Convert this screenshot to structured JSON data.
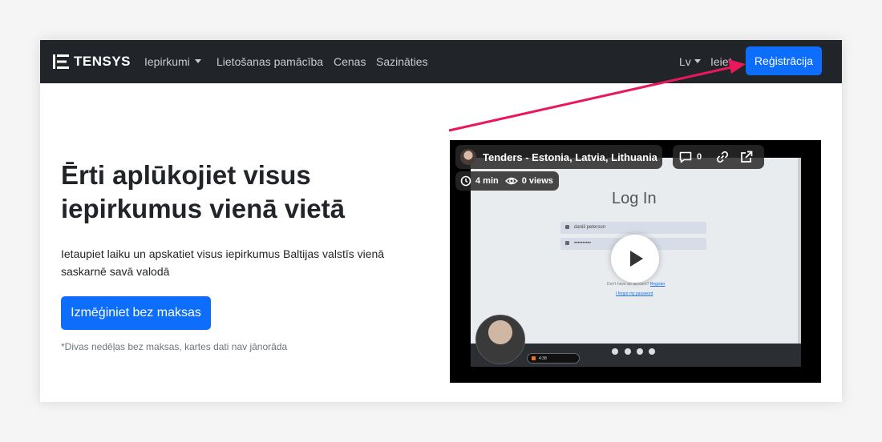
{
  "brand": {
    "logo_text": "TENSYS"
  },
  "nav": {
    "items": [
      {
        "label": "Iepirkumi",
        "dropdown": true
      },
      {
        "label": "Lietošanas pamācība"
      },
      {
        "label": "Cenas"
      },
      {
        "label": "Sazināties"
      }
    ],
    "language": "Lv",
    "login": "Ieiet",
    "register": "Reģistrācija"
  },
  "hero": {
    "title": "Ērti aplūkojiet visus iepirkumus vienā vietā",
    "description": "Ietaupiet laiku un apskatiet visus iepirkumus Baltijas valstīs vienā saskarnē savā valodā",
    "cta": "Izmēģiniet bez maksas",
    "footnote": "*Divas nedēļas bez maksas, kartes dati nav jānorāda"
  },
  "video": {
    "title": "Tenders - Estonia, Latvia, Lithuania",
    "duration": "4 min",
    "views": "0 views",
    "comments": "0",
    "screen": {
      "heading": "Log In",
      "username_value": "daniil peterson",
      "password_value": "••••••••••",
      "no_account_text": "Don't have an account?",
      "register_link": "Register",
      "forgot_link": "I forgot my password",
      "rec_time": "4:38"
    }
  },
  "colors": {
    "accent": "#0d6efd",
    "navbar": "#212529",
    "arrow": "#e8185a"
  },
  "icons": [
    "logo-icon",
    "clock-icon",
    "eye-icon",
    "comment-icon",
    "link-icon",
    "external-link-icon",
    "play-icon",
    "user-icon",
    "lock-icon"
  ]
}
